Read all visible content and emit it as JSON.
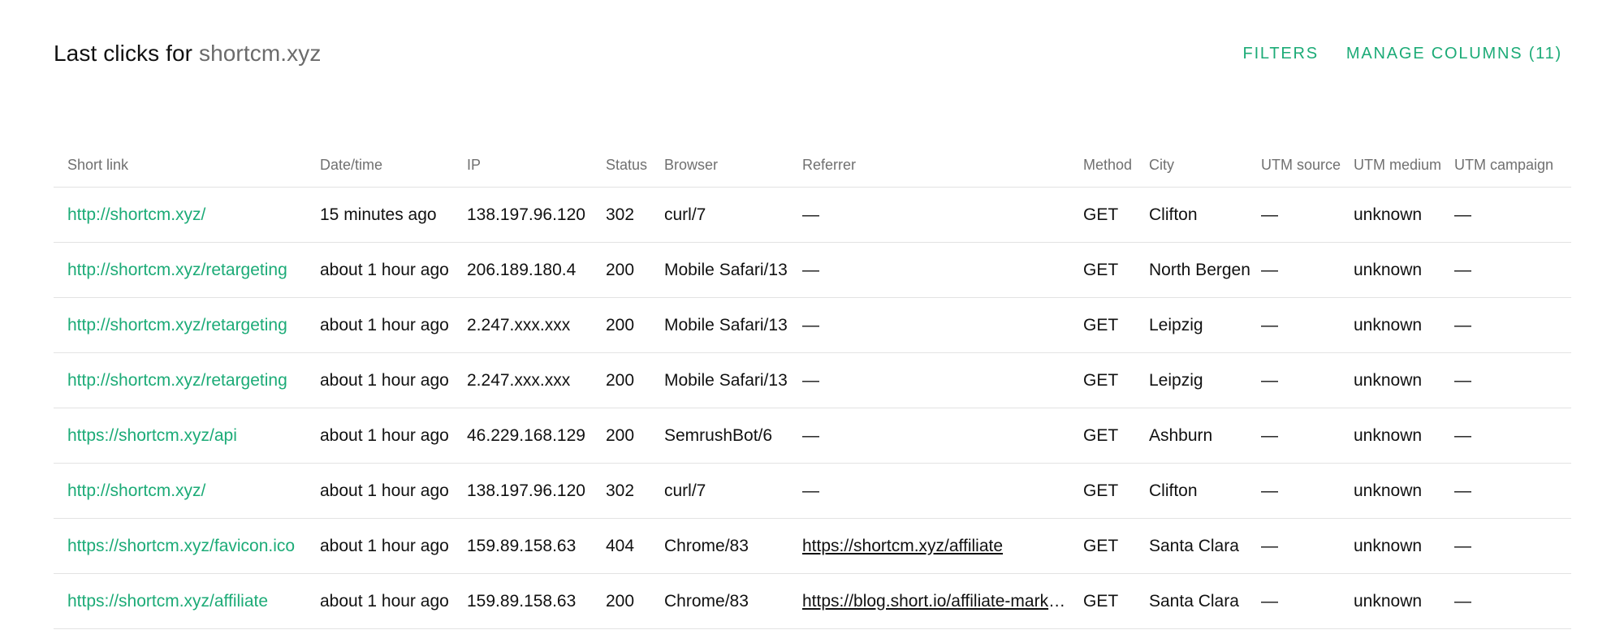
{
  "header": {
    "title_prefix": "Last clicks for ",
    "title_domain": "shortcm.xyz",
    "filters_label": "FILTERS",
    "manage_columns_label": "MANAGE COLUMNS (11)"
  },
  "colors": {
    "accent": "#1cab77",
    "muted_text": "#6b6b6b",
    "divider": "#e3e3e3"
  },
  "table": {
    "columns": [
      "Short link",
      "Date/time",
      "IP",
      "Status",
      "Browser",
      "Referrer",
      "Method",
      "City",
      "UTM source",
      "UTM medium",
      "UTM campaign"
    ],
    "rows": [
      {
        "short_link": "http://shortcm.xyz/",
        "datetime": "15 minutes ago",
        "ip": "138.197.96.120",
        "status": "302",
        "browser": "curl/7",
        "referrer": "—",
        "referrer_is_link": false,
        "method": "GET",
        "city": "Clifton",
        "utm_source": "—",
        "utm_medium": "unknown",
        "utm_campaign": "—"
      },
      {
        "short_link": "http://shortcm.xyz/retargeting",
        "datetime": "about 1 hour ago",
        "ip": "206.189.180.4",
        "status": "200",
        "browser": "Mobile Safari/13",
        "referrer": "—",
        "referrer_is_link": false,
        "method": "GET",
        "city": "North Bergen",
        "utm_source": "—",
        "utm_medium": "unknown",
        "utm_campaign": "—"
      },
      {
        "short_link": "http://shortcm.xyz/retargeting",
        "datetime": "about 1 hour ago",
        "ip": "2.247.xxx.xxx",
        "status": "200",
        "browser": "Mobile Safari/13",
        "referrer": "—",
        "referrer_is_link": false,
        "method": "GET",
        "city": "Leipzig",
        "utm_source": "—",
        "utm_medium": "unknown",
        "utm_campaign": "—"
      },
      {
        "short_link": "http://shortcm.xyz/retargeting",
        "datetime": "about 1 hour ago",
        "ip": "2.247.xxx.xxx",
        "status": "200",
        "browser": "Mobile Safari/13",
        "referrer": "—",
        "referrer_is_link": false,
        "method": "GET",
        "city": "Leipzig",
        "utm_source": "—",
        "utm_medium": "unknown",
        "utm_campaign": "—"
      },
      {
        "short_link": "https://shortcm.xyz/api",
        "datetime": "about 1 hour ago",
        "ip": "46.229.168.129",
        "status": "200",
        "browser": "SemrushBot/6",
        "referrer": "—",
        "referrer_is_link": false,
        "method": "GET",
        "city": "Ashburn",
        "utm_source": "—",
        "utm_medium": "unknown",
        "utm_campaign": "—"
      },
      {
        "short_link": "http://shortcm.xyz/",
        "datetime": "about 1 hour ago",
        "ip": "138.197.96.120",
        "status": "302",
        "browser": "curl/7",
        "referrer": "—",
        "referrer_is_link": false,
        "method": "GET",
        "city": "Clifton",
        "utm_source": "—",
        "utm_medium": "unknown",
        "utm_campaign": "—"
      },
      {
        "short_link": "https://shortcm.xyz/favicon.ico",
        "datetime": "about 1 hour ago",
        "ip": "159.89.158.63",
        "status": "404",
        "browser": "Chrome/83",
        "referrer": "https://shortcm.xyz/affiliate",
        "referrer_is_link": true,
        "method": "GET",
        "city": "Santa Clara",
        "utm_source": "—",
        "utm_medium": "unknown",
        "utm_campaign": "—"
      },
      {
        "short_link": "https://shortcm.xyz/affiliate",
        "datetime": "about 1 hour ago",
        "ip": "159.89.158.63",
        "status": "200",
        "browser": "Chrome/83",
        "referrer": "https://blog.short.io/affiliate-marke…",
        "referrer_is_link": true,
        "method": "GET",
        "city": "Santa Clara",
        "utm_source": "—",
        "utm_medium": "unknown",
        "utm_campaign": "—"
      }
    ]
  }
}
